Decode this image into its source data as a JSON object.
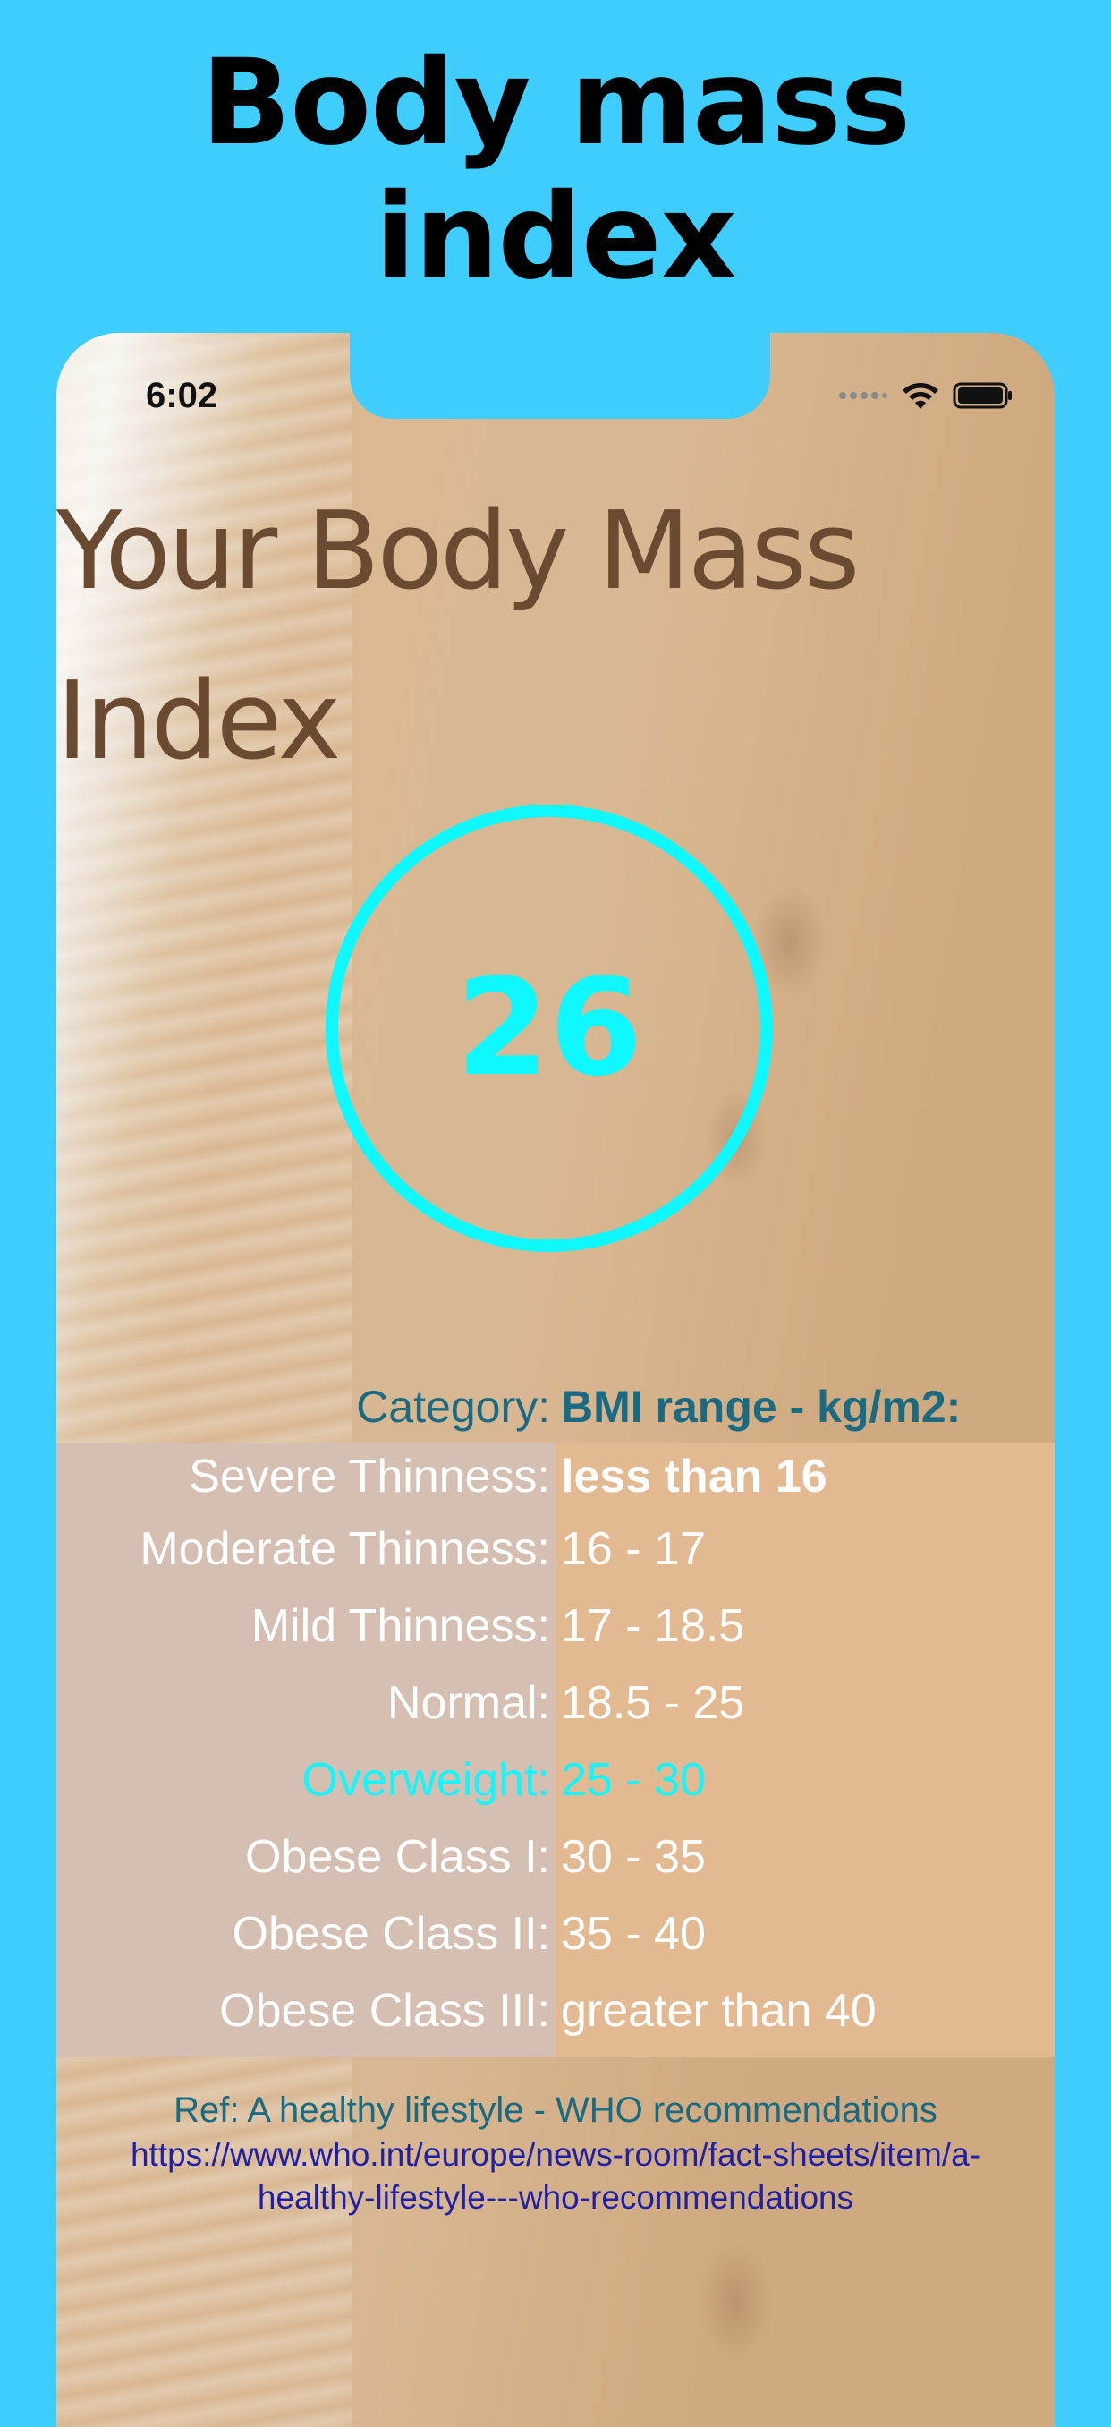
{
  "promo": {
    "title_line1": "Body mass",
    "title_line2": "index"
  },
  "status_bar": {
    "time": "6:02",
    "icons": [
      "signal-dots-icon",
      "wifi-icon",
      "battery-icon"
    ]
  },
  "app": {
    "title_line1": "Your Body Mass",
    "title_line2": "Index",
    "bmi_value": "26",
    "table": {
      "header_category": "Category:",
      "header_range": "BMI range - kg/m2:",
      "rows": [
        {
          "category": "Severe Thinness:",
          "range": "less than 16"
        },
        {
          "category": "Moderate Thinness:",
          "range": "16 - 17"
        },
        {
          "category": "Mild Thinness:",
          "range": "17 - 18.5"
        },
        {
          "category": "Normal:",
          "range": "18.5 - 25"
        },
        {
          "category": "Overweight:",
          "range": "25 - 30"
        },
        {
          "category": "Obese Class I:",
          "range": "30 - 35"
        },
        {
          "category": "Obese Class II:",
          "range": "35 - 40"
        },
        {
          "category": "Obese Class III:",
          "range": "greater than 40"
        }
      ]
    },
    "reference": {
      "title": "Ref: A healthy lifestyle - WHO recommendations",
      "link_line1": "https://www.who.int/europe/news-room/fact-sheets/item/a-",
      "link_line2": "healthy-lifestyle---who-recommendations"
    }
  },
  "colors": {
    "background": "#3ecdfd",
    "accent": "#0ff7ff",
    "title_brown": "#6a4a30",
    "header_teal": "#1a6b82",
    "link_blue": "#1f1fa8"
  }
}
